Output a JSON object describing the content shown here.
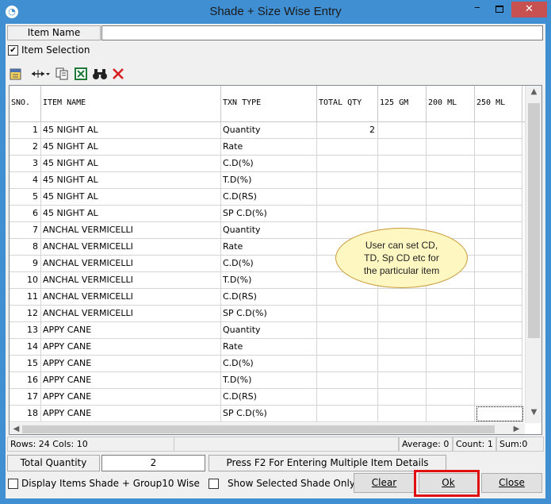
{
  "window": {
    "title": "Shade + Size Wise Entry",
    "min_glyph": "‒",
    "close_glyph": "✕"
  },
  "item_name": {
    "label": "Item Name",
    "value": ""
  },
  "item_selection": {
    "label": "Item Selection",
    "checked": true
  },
  "toolbar": {
    "icons": [
      "notebook-icon",
      "resize-columns-icon",
      "copy-icon",
      "excel-icon",
      "binoculars-icon",
      "delete-icon"
    ]
  },
  "grid": {
    "columns": [
      "SNO.",
      "ITEM NAME",
      "TXN TYPE",
      "TOTAL QTY",
      "125 GM",
      "200 ML",
      "250 ML"
    ],
    "rows": [
      {
        "sno": "1",
        "item": "45 NIGHT AL",
        "txn": "Quantity",
        "total": "2"
      },
      {
        "sno": "2",
        "item": "45 NIGHT AL",
        "txn": "Rate",
        "total": ""
      },
      {
        "sno": "3",
        "item": "45 NIGHT AL",
        "txn": "C.D(%)",
        "total": ""
      },
      {
        "sno": "4",
        "item": "45 NIGHT AL",
        "txn": "T.D(%)",
        "total": ""
      },
      {
        "sno": "5",
        "item": "45 NIGHT AL",
        "txn": "C.D(RS)",
        "total": ""
      },
      {
        "sno": "6",
        "item": "45 NIGHT AL",
        "txn": "SP C.D(%)",
        "total": ""
      },
      {
        "sno": "7",
        "item": "ANCHAL VERMICELLI",
        "txn": "Quantity",
        "total": ""
      },
      {
        "sno": "8",
        "item": "ANCHAL VERMICELLI",
        "txn": "Rate",
        "total": ""
      },
      {
        "sno": "9",
        "item": "ANCHAL VERMICELLI",
        "txn": "C.D(%)",
        "total": ""
      },
      {
        "sno": "10",
        "item": "ANCHAL VERMICELLI",
        "txn": "T.D(%)",
        "total": ""
      },
      {
        "sno": "11",
        "item": "ANCHAL VERMICELLI",
        "txn": "C.D(RS)",
        "total": ""
      },
      {
        "sno": "12",
        "item": "ANCHAL VERMICELLI",
        "txn": "SP C.D(%)",
        "total": ""
      },
      {
        "sno": "13",
        "item": "APPY CANE",
        "txn": "Quantity",
        "total": ""
      },
      {
        "sno": "14",
        "item": "APPY CANE",
        "txn": "Rate",
        "total": ""
      },
      {
        "sno": "15",
        "item": "APPY CANE",
        "txn": "C.D(%)",
        "total": ""
      },
      {
        "sno": "16",
        "item": "APPY CANE",
        "txn": "T.D(%)",
        "total": ""
      },
      {
        "sno": "17",
        "item": "APPY CANE",
        "txn": "C.D(RS)",
        "total": ""
      },
      {
        "sno": "18",
        "item": "APPY CANE",
        "txn": "SP C.D(%)",
        "total": ""
      }
    ]
  },
  "callout": {
    "text_lines": [
      "User can set CD,",
      "TD, Sp CD etc for",
      "the particular item"
    ]
  },
  "status": {
    "rows_cols": "Rows: 24  Cols: 10",
    "average": "Average: 0",
    "count": "Count: 1",
    "sum": "Sum:0"
  },
  "total_quantity": {
    "label": "Total Quantity",
    "value": "2",
    "hint": "Press F2 For Entering Multiple Item Details"
  },
  "options": {
    "display_shade": "Display Items Shade + Group10 Wise",
    "show_selected": "Show Selected Shade Only"
  },
  "buttons": {
    "clear": "Clear",
    "ok": "Ok",
    "close": "Close"
  },
  "colors": {
    "title_bar": "#3f8fd2",
    "close_button": "#c75050",
    "highlight": "#e01010"
  }
}
